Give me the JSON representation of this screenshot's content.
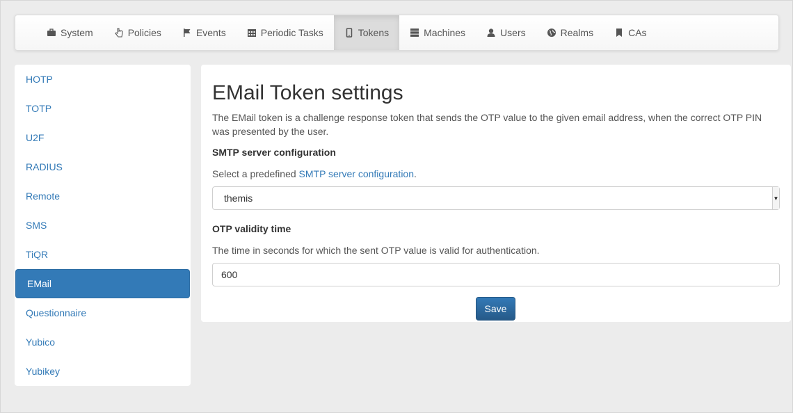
{
  "nav": {
    "items": [
      {
        "label": "System",
        "icon": "briefcase-icon"
      },
      {
        "label": "Policies",
        "icon": "hand-pointer-icon"
      },
      {
        "label": "Events",
        "icon": "flag-icon"
      },
      {
        "label": "Periodic Tasks",
        "icon": "calendar-icon"
      },
      {
        "label": "Tokens",
        "icon": "phone-icon"
      },
      {
        "label": "Machines",
        "icon": "server-icon"
      },
      {
        "label": "Users",
        "icon": "user-icon"
      },
      {
        "label": "Realms",
        "icon": "globe-icon"
      },
      {
        "label": "CAs",
        "icon": "bookmark-icon"
      }
    ],
    "active": "Tokens"
  },
  "sidebar": {
    "items": [
      {
        "label": "HOTP"
      },
      {
        "label": "TOTP"
      },
      {
        "label": "U2F"
      },
      {
        "label": "RADIUS"
      },
      {
        "label": "Remote"
      },
      {
        "label": "SMS"
      },
      {
        "label": "TiQR"
      },
      {
        "label": "EMail"
      },
      {
        "label": "Questionnaire"
      },
      {
        "label": "Yubico"
      },
      {
        "label": "Yubikey"
      }
    ],
    "active": "EMail"
  },
  "main": {
    "title": "EMail Token settings",
    "description": "The EMail token is a challenge response token that sends the OTP value to the given email address, when the correct OTP PIN was presented by the user.",
    "smtp": {
      "label": "SMTP server configuration",
      "help_prefix": "Select a predefined ",
      "help_link": "SMTP server configuration",
      "help_suffix": ".",
      "selected": "themis"
    },
    "validity": {
      "label": "OTP validity time",
      "help": "The time in seconds for which the sent OTP value is valid for authentication.",
      "value": "600"
    },
    "save_label": "Save"
  },
  "colors": {
    "accent": "#337ab7",
    "background": "#ececec"
  }
}
